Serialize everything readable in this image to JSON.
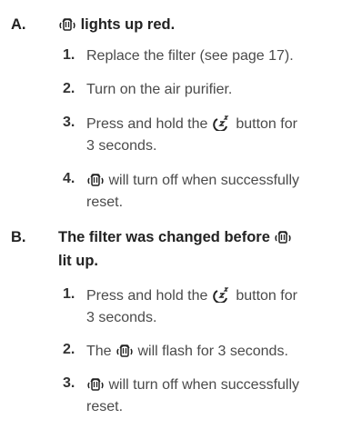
{
  "sections": [
    {
      "letter": "A.",
      "title_text": "lights up red.",
      "icon": "filter-reset-icon",
      "steps": [
        {
          "num": "1.",
          "text": "Replace the filter (see page 17)."
        },
        {
          "num": "2.",
          "text": "Turn on the air purifier."
        },
        {
          "num": "3.",
          "pre": "Press and hold the",
          "icon": "sleep-mode-icon",
          "post": "button for",
          "line2": "3 seconds."
        },
        {
          "num": "4.",
          "icon": "filter-reset-icon",
          "post": "will turn off when successfully",
          "line2": "reset."
        }
      ]
    },
    {
      "letter": "B.",
      "title_line1": "The filter was changed before",
      "title_line2": "lit up.",
      "icon": "filter-reset-icon",
      "steps": [
        {
          "num": "1.",
          "pre": "Press and hold the",
          "icon": "sleep-mode-icon",
          "post": "button for",
          "line2": "3 seconds."
        },
        {
          "num": "2.",
          "pre": "The",
          "icon": "filter-reset-icon",
          "post": "will flash for 3 seconds."
        },
        {
          "num": "3.",
          "icon": "filter-reset-icon",
          "post": "will turn off when successfully",
          "line2": "reset."
        }
      ]
    }
  ]
}
